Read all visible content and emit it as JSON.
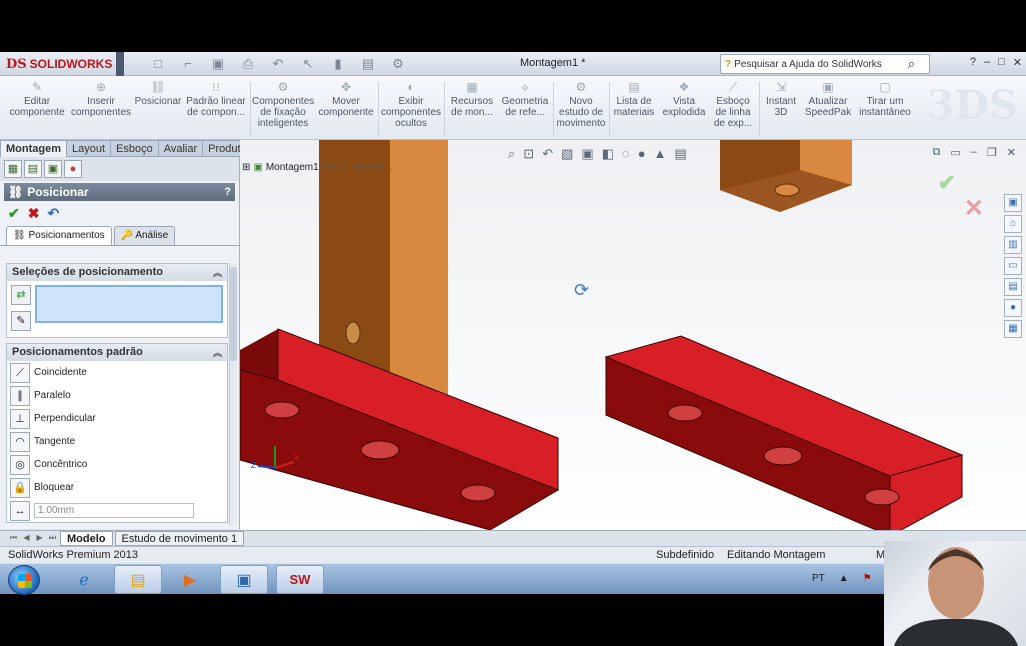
{
  "app": {
    "logo_text": "SOLIDWORKS",
    "logo_mark": "DS",
    "document_title": "Montagem1 *",
    "help_search_placeholder": "Pesquisar a Ajuda do SolidWorks",
    "window_controls": [
      "?",
      "–",
      "□",
      "✕"
    ]
  },
  "command_manager": {
    "items": [
      {
        "label": "Editar\ncomponente",
        "icon": "edit-component-icon"
      },
      {
        "label": "Inserir\ncomponentes",
        "icon": "insert-components-icon"
      },
      {
        "label": "Posicionar",
        "icon": "mate-icon"
      },
      {
        "label": "Padrão linear\nde compon...",
        "icon": "linear-pattern-icon"
      },
      {
        "label": "Componentes\nde fixação\ninteligentes",
        "icon": "smart-fasteners-icon"
      },
      {
        "label": "Mover\ncomponente",
        "icon": "move-component-icon"
      },
      {
        "label": "Exibir\ncomponentes\nocultos",
        "icon": "show-hidden-icon"
      },
      {
        "label": "Recursos\nde mon...",
        "icon": "assembly-features-icon"
      },
      {
        "label": "Geometria\nde refe...",
        "icon": "reference-geometry-icon"
      },
      {
        "label": "Novo\nestudo de\nmovimento",
        "icon": "new-motion-study-icon"
      },
      {
        "label": "Lista de\nmateriais",
        "icon": "bom-icon"
      },
      {
        "label": "Vista\nexplodida",
        "icon": "exploded-view-icon"
      },
      {
        "label": "Esboço\nde linha\nde exp...",
        "icon": "explode-line-sketch-icon"
      },
      {
        "label": "Instant\n3D",
        "icon": "instant3d-icon"
      },
      {
        "label": "Atualizar\nSpeedPak",
        "icon": "speedpak-icon"
      },
      {
        "label": "Tirar um\ninstantâneo",
        "icon": "snapshot-icon"
      }
    ]
  },
  "tabs": [
    "Montagem",
    "Layout",
    "Esboço",
    "Avaliar",
    "Produtos Office"
  ],
  "property_manager": {
    "title": "Posicionar",
    "help": "?",
    "subtabs": [
      "Posicionamentos",
      "Análise"
    ],
    "selections_header": "Seleções de posicionamento",
    "standard_header": "Posicionamentos padrão",
    "mates": [
      {
        "label": "Coincidente",
        "icon": "coincident-icon",
        "glyph": "⟋"
      },
      {
        "label": "Paralelo",
        "icon": "parallel-icon",
        "glyph": "∥"
      },
      {
        "label": "Perpendicular",
        "icon": "perpendicular-icon",
        "glyph": "⊥"
      },
      {
        "label": "Tangente",
        "icon": "tangent-icon",
        "glyph": "◠"
      },
      {
        "label": "Concêntrico",
        "icon": "concentric-icon",
        "glyph": "◎"
      },
      {
        "label": "Bloquear",
        "icon": "lock-icon",
        "glyph": "🔒"
      }
    ],
    "distance_value": "1.00mm"
  },
  "viewport": {
    "tree_label": "Montagem1",
    "tree_sublabel": "(Valor predete..."
  },
  "bottom_tabs": [
    "Modelo",
    "Estudo de movimento 1"
  ],
  "status": {
    "product": "SolidWorks Premium 2013",
    "definition": "Subdefinido",
    "mode": "Editando Montagem",
    "extra": "M"
  },
  "taskbar": {
    "language": "PT"
  },
  "colors": {
    "part_red": "#d81f26",
    "part_brown": "#8b4a14",
    "part_orange": "#d9883f",
    "accent_blue": "#3d7fc3"
  }
}
